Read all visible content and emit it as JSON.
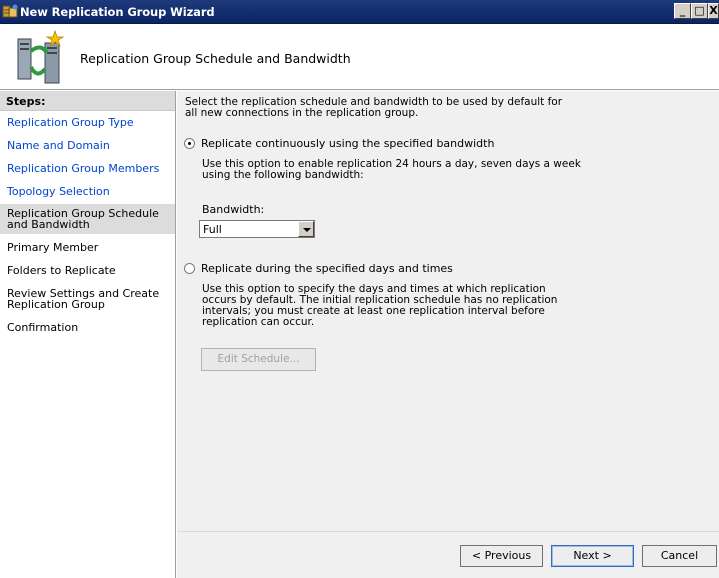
{
  "window": {
    "title": "New Replication Group Wizard",
    "controls": {
      "minimize": "_",
      "maximize": "□",
      "close": "X"
    }
  },
  "header": {
    "title": "Replication Group Schedule and Bandwidth",
    "icon": "replication-servers-icon"
  },
  "steps": {
    "heading": "Steps:",
    "items": [
      {
        "label": "Replication Group Type",
        "state": "link"
      },
      {
        "label": "Name and Domain",
        "state": "link"
      },
      {
        "label": "Replication Group Members",
        "state": "link"
      },
      {
        "label": "Topology Selection",
        "state": "link"
      },
      {
        "label": "Replication Group Schedule and Bandwidth",
        "state": "current"
      },
      {
        "label": "Primary Member",
        "state": "plain"
      },
      {
        "label": "Folders to Replicate",
        "state": "plain"
      },
      {
        "label": "Review Settings and Create Replication Group",
        "state": "plain"
      },
      {
        "label": "Confirmation",
        "state": "plain"
      }
    ]
  },
  "content": {
    "intro": "Select the replication schedule and bandwidth to be used by default for all new connections in the replication group.",
    "option_continuous": {
      "label": "Replicate continuously using the specified bandwidth",
      "selected": true,
      "description": "Use this option to enable replication 24 hours a day, seven days a week using the following bandwidth:"
    },
    "bandwidth": {
      "label": "Bandwidth:",
      "value": "Full"
    },
    "option_specified": {
      "label": "Replicate during the specified days and times",
      "selected": false,
      "description": "Use this option to specify the days and times at which replication occurs by default. The initial replication schedule has no replication intervals; you must create at least one replication interval before replication can occur."
    },
    "edit_schedule": "Edit Schedule..."
  },
  "footer": {
    "previous": "< Previous",
    "next": "Next >",
    "cancel": "Cancel"
  }
}
